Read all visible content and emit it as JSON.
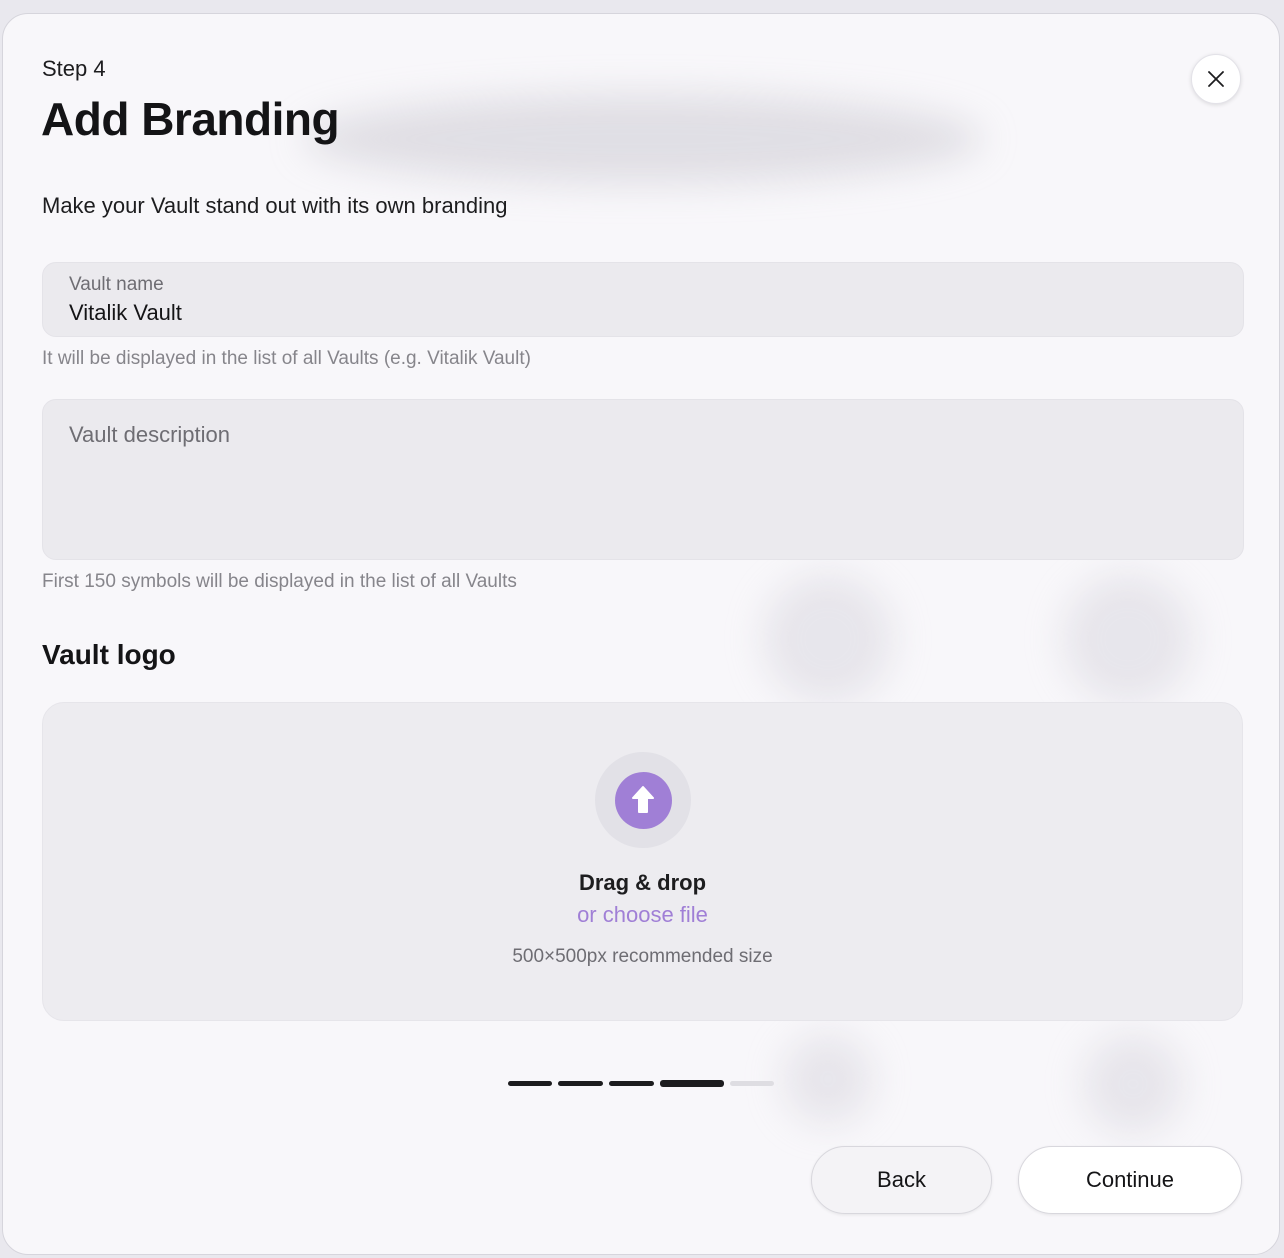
{
  "header": {
    "step": "Step 4",
    "title": "Add Branding",
    "subtitle": "Make your Vault stand out with its own branding"
  },
  "close_icon": "close-icon",
  "vault_name": {
    "label": "Vault name",
    "value": "Vitalik Vault",
    "hint": "It will be displayed in the list of all Vaults (e.g. Vitalik Vault)"
  },
  "vault_description": {
    "placeholder": "Vault description",
    "hint": "First 150 symbols will be displayed in the list of all Vaults"
  },
  "vault_logo": {
    "heading": "Vault logo",
    "icon": "upload-arrow-icon",
    "drag_text": "Drag & drop",
    "choose_file": "or choose file",
    "size_note": "500×500px recommended size"
  },
  "progress": {
    "total_steps": 5,
    "current_step": 4
  },
  "colors": {
    "accent": "#a07fd6",
    "progress_done": "#1c1c1e",
    "progress_pending": "#dedde2"
  },
  "footer": {
    "back_label": "Back",
    "continue_label": "Continue"
  }
}
